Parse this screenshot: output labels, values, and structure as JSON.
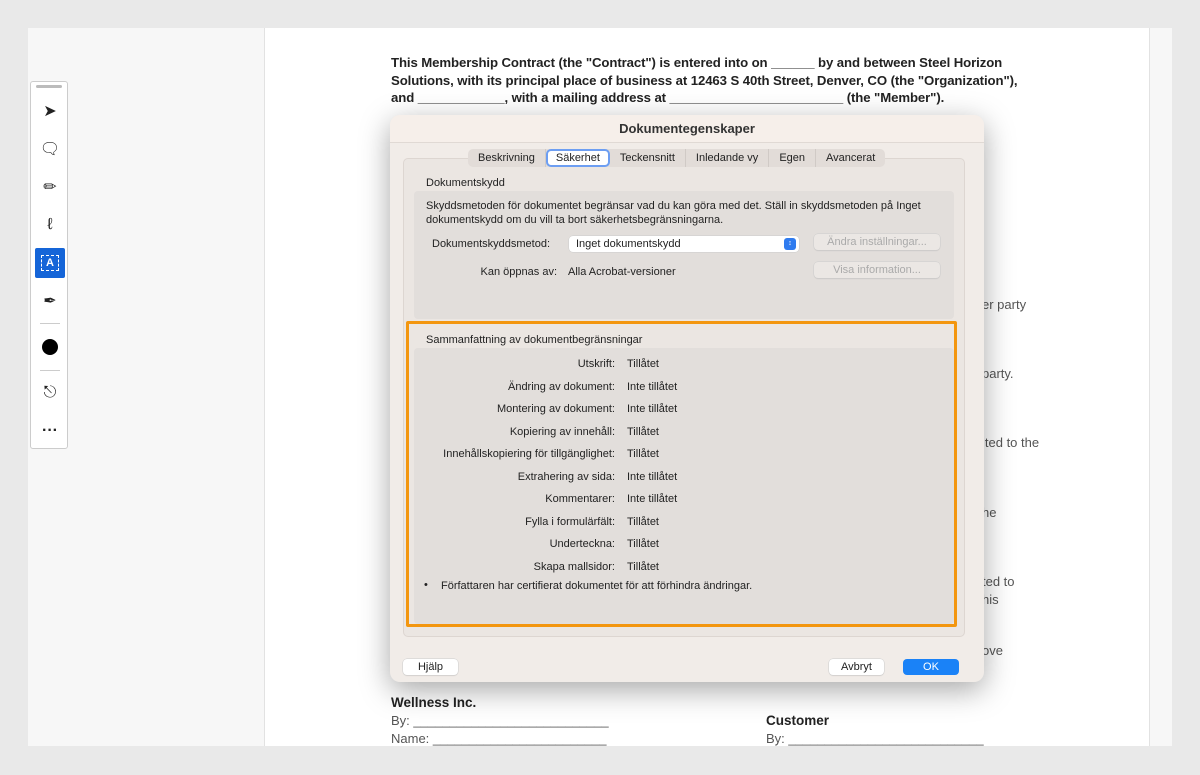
{
  "document": {
    "intro": "This Membership Contract (the \"Contract\") is entered into on ______ by and between Steel Horizon Solutions, with its principal place of business at 12463 S 40th Street, Denver, CO (the \"Organization\"), and ____________, with a mailing address at ________________________ (the \"Member\").",
    "fragments": [
      "er party",
      "party.",
      "ited to the",
      "he",
      "ted to",
      "his",
      "ove"
    ],
    "sig_left_title": "Wellness Inc.",
    "sig_left_by": "By: ___________________________",
    "sig_left_name": "Name: ________________________",
    "sig_right_title": "Customer",
    "sig_right_by": "By: ___________________________"
  },
  "toolbar": {
    "tools": [
      "select-icon",
      "comment-icon",
      "highlight-icon",
      "draw-icon",
      "text-select-icon",
      "sign-icon",
      "color-icon",
      "stamp-icon",
      "more-icon"
    ],
    "active": "text-select-icon",
    "active_color": "#1565d8"
  },
  "dialog": {
    "title": "Dokumentegenskaper",
    "tabs": [
      "Beskrivning",
      "Säkerhet",
      "Teckensnitt",
      "Inledande vy",
      "Egen",
      "Avancerat"
    ],
    "selected_tab": "Säkerhet",
    "protection": {
      "heading": "Dokumentskydd",
      "description": "Skyddsmetoden för dokumentet begränsar vad du kan göra med det. Ställ in skyddsmetoden på Inget dokumentskydd om du vill ta bort säkerhetsbegränsningarna.",
      "method_label": "Dokumentskyddsmetod:",
      "method_value": "Inget dokumentskydd",
      "change_button": "Ändra inställningar...",
      "open_label": "Kan öppnas av:",
      "open_value": "Alla Acrobat-versioner",
      "info_button": "Visa information..."
    },
    "summary": {
      "heading": "Sammanfattning av dokumentbegränsningar",
      "rows": [
        {
          "label": "Utskrift:",
          "value": "Tillåtet"
        },
        {
          "label": "Ändring av dokument:",
          "value": "Inte tillåtet"
        },
        {
          "label": "Montering av dokument:",
          "value": "Inte tillåtet"
        },
        {
          "label": "Kopiering av innehåll:",
          "value": "Tillåtet"
        },
        {
          "label": "Innehållskopiering för tillgänglighet:",
          "value": "Tillåtet"
        },
        {
          "label": "Extrahering av sida:",
          "value": "Inte tillåtet"
        },
        {
          "label": "Kommentarer:",
          "value": "Inte tillåtet"
        },
        {
          "label": "Fylla i formulärfält:",
          "value": "Tillåtet"
        },
        {
          "label": "Underteckna:",
          "value": "Tillåtet"
        },
        {
          "label": "Skapa mallsidor:",
          "value": "Tillåtet"
        }
      ],
      "note_bullet": "•",
      "note": "Författaren har certifierat dokumentet för att förhindra ändringar."
    },
    "help_button": "Hjälp",
    "cancel_button": "Avbryt",
    "ok_button": "OK",
    "highlight_color": "#f3960f"
  }
}
